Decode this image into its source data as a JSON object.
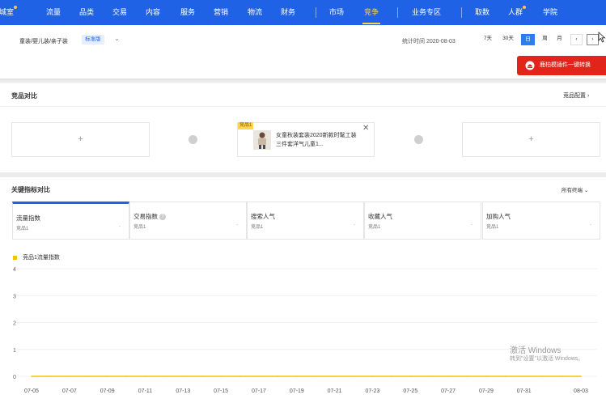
{
  "nav": {
    "items": [
      {
        "label": "城室",
        "active": false,
        "dot": true
      },
      {
        "label": "流量",
        "active": false,
        "dot": false
      },
      {
        "label": "品类",
        "active": false,
        "dot": false
      },
      {
        "label": "交易",
        "active": false,
        "dot": false
      },
      {
        "label": "内容",
        "active": false,
        "dot": false
      },
      {
        "label": "服务",
        "active": false,
        "dot": false
      },
      {
        "label": "营销",
        "active": false,
        "dot": false
      },
      {
        "label": "物流",
        "active": false,
        "dot": false
      },
      {
        "label": "财务",
        "active": false,
        "dot": false
      },
      {
        "label": "市场",
        "active": false,
        "dot": false
      },
      {
        "label": "竞争",
        "active": true,
        "dot": false
      },
      {
        "label": "业务专区",
        "active": false,
        "dot": false
      },
      {
        "label": "取数",
        "active": false,
        "dot": false
      },
      {
        "label": "人群",
        "active": false,
        "dot": true
      },
      {
        "label": "学院",
        "active": false,
        "dot": false
      }
    ],
    "bg_color": "#2062e6",
    "active_color": "#ffd24d"
  },
  "subheader": {
    "category": "童装/婴儿装/亲子装",
    "edition_badge": "标准版",
    "stat_time": "统计时间 2020-08-03",
    "ranges": [
      {
        "label": "7天",
        "active": false
      },
      {
        "label": "30天",
        "active": false
      },
      {
        "label": "日",
        "active": true
      },
      {
        "label": "周",
        "active": false
      },
      {
        "label": "月",
        "active": false
      }
    ],
    "prev_icon": "chevron-left-icon",
    "next_icon": "chevron-right-icon",
    "plugin_button": "鹿柏模插件一键转换"
  },
  "compare": {
    "title": "竞品对比",
    "config_link": "竞品配置",
    "slot_plus": "+",
    "product": {
      "tag": "竞品1",
      "name": "女童秋装套装2020新款时髦工装三件套洋气儿童1..."
    }
  },
  "metrics": {
    "title": "关键指标对比",
    "terminal": "所有终端",
    "tabs": [
      {
        "name": "流量指数",
        "sub": "竞品1",
        "dash": "-",
        "active": true,
        "info": false
      },
      {
        "name": "交易指数",
        "sub": "竞品1",
        "dash": "-",
        "active": false,
        "info": true
      },
      {
        "name": "搜索人气",
        "sub": "竞品1",
        "dash": "-",
        "active": false,
        "info": false
      },
      {
        "name": "收藏人气",
        "sub": "竞品1",
        "dash": "-",
        "active": false,
        "info": false
      },
      {
        "name": "加购人气",
        "sub": "竞品1",
        "dash": "-",
        "active": false,
        "info": false
      }
    ]
  },
  "chart_data": {
    "type": "line",
    "title": "",
    "xlabel": "",
    "ylabel": "",
    "x": [
      "07-05",
      "07-06",
      "07-07",
      "07-08",
      "07-09",
      "07-10",
      "07-11",
      "07-12",
      "07-13",
      "07-14",
      "07-15",
      "07-16",
      "07-17",
      "07-18",
      "07-19",
      "07-20",
      "07-21",
      "07-22",
      "07-23",
      "07-24",
      "07-25",
      "07-26",
      "07-27",
      "07-28",
      "07-29",
      "07-30",
      "07-31",
      "08-01",
      "08-02",
      "08-03"
    ],
    "x_tick_labels": [
      "07-05",
      "07-07",
      "07-09",
      "07-11",
      "07-13",
      "07-15",
      "07-17",
      "07-19",
      "07-21",
      "07-23",
      "07-25",
      "07-27",
      "07-29",
      "07-31",
      "08-03"
    ],
    "y_ticks": [
      "0",
      "1",
      "2",
      "3",
      "4"
    ],
    "ylim": [
      0,
      4
    ],
    "grid": true,
    "legend": "top-left",
    "series": [
      {
        "name": "竞品1流量指数",
        "color": "#f5c400",
        "values": [
          0,
          0,
          0,
          0,
          0,
          0,
          0,
          0,
          0,
          0,
          0,
          0,
          0,
          0,
          0,
          0,
          0,
          0,
          0,
          0,
          0,
          0,
          0,
          0,
          0,
          0,
          0,
          0,
          0,
          0
        ]
      }
    ]
  },
  "watermark": {
    "line1": "激活 Windows",
    "line2": "转到\"设置\"以激活 Windows。"
  }
}
